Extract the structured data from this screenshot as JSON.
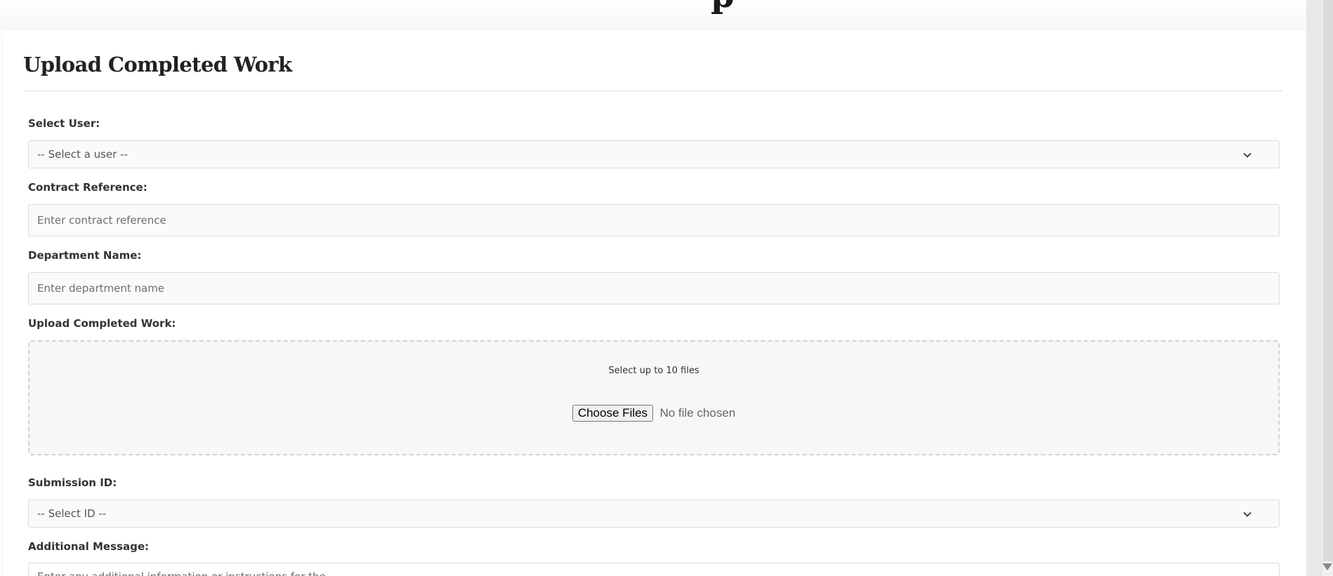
{
  "header": {
    "partial_heading_glyph": "p"
  },
  "form": {
    "title": "Upload Completed Work",
    "user": {
      "label": "Select User:",
      "selected": "-- Select a user --"
    },
    "contract": {
      "label": "Contract Reference:",
      "placeholder": "Enter contract reference"
    },
    "department": {
      "label": "Department Name:",
      "placeholder": "Enter department name"
    },
    "upload": {
      "label": "Upload Completed Work:",
      "hint": "Select up to 10 files",
      "button_label": "Choose Files",
      "status": "No file chosen"
    },
    "submission": {
      "label": "Submission ID:",
      "selected": "-- Select ID --"
    },
    "message": {
      "label": "Additional Message:",
      "placeholder": "Enter any additional information or instructions for the..."
    }
  },
  "icons": {
    "select_chevron": "chevron-down-icon",
    "scroll_arrow": "scroll-down-arrow-icon"
  },
  "colors": {
    "page_background": "#ffffff",
    "title_text": "#222222",
    "label_text": "#333333",
    "border": "#dcdcdc",
    "field_background": "#fafafa",
    "upload_zone_background": "#f7f7f7"
  }
}
